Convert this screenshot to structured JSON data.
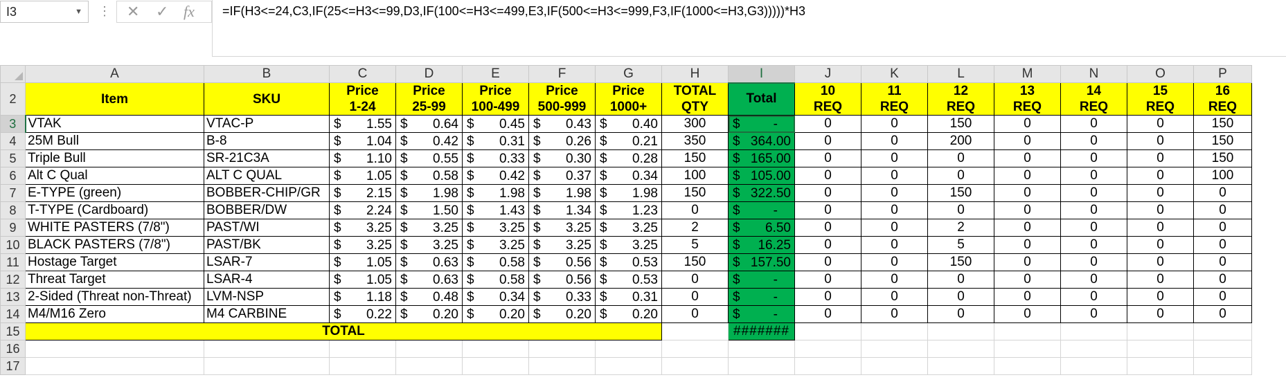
{
  "formula_bar": {
    "name_box": "I3",
    "formula": "=IF(H3<=24,C3,IF(25<=H3<=99,D3,IF(100<=H3<=499,E3,IF(500<=H3<=999,F3,IF(1000<=H3,G3)))))*H3",
    "cancel_glyph": "✕",
    "enter_glyph": "✓",
    "fx_glyph": "fx"
  },
  "columns": [
    "A",
    "B",
    "C",
    "D",
    "E",
    "F",
    "G",
    "H",
    "I",
    "J",
    "K",
    "L",
    "M",
    "N",
    "O",
    "P"
  ],
  "selected_column": "I",
  "selected_row": "3",
  "header_row": {
    "row_num": "2",
    "item": "Item",
    "sku": "SKU",
    "price_labels": [
      {
        "l1": "Price",
        "l2": "1-24"
      },
      {
        "l1": "Price",
        "l2": "25-99"
      },
      {
        "l1": "Price",
        "l2": "100-499"
      },
      {
        "l1": "Price",
        "l2": "500-999"
      },
      {
        "l1": "Price",
        "l2": "1000+"
      }
    ],
    "total_qty": {
      "l1": "TOTAL",
      "l2": "QTY"
    },
    "total": "Total",
    "req_labels": [
      {
        "l1": "10",
        "l2": "REQ"
      },
      {
        "l1": "11",
        "l2": "REQ"
      },
      {
        "l1": "12",
        "l2": "REQ"
      },
      {
        "l1": "13",
        "l2": "REQ"
      },
      {
        "l1": "14",
        "l2": "REQ"
      },
      {
        "l1": "15",
        "l2": "REQ"
      },
      {
        "l1": "16",
        "l2": "REQ"
      }
    ]
  },
  "currency_symbol": "$",
  "rows": [
    {
      "n": "3",
      "item": "VTAK",
      "sku": "VTAC-P",
      "prices": [
        "1.55",
        "0.64",
        "0.45",
        "0.43",
        "0.40"
      ],
      "qty": "300",
      "total": "-",
      "req": [
        "0",
        "0",
        "150",
        "0",
        "0",
        "0",
        "150"
      ]
    },
    {
      "n": "4",
      "item": "25M Bull",
      "sku": "B-8",
      "prices": [
        "1.04",
        "0.42",
        "0.31",
        "0.26",
        "0.21"
      ],
      "qty": "350",
      "total": "364.00",
      "req": [
        "0",
        "0",
        "200",
        "0",
        "0",
        "0",
        "150"
      ]
    },
    {
      "n": "5",
      "item": "Triple Bull",
      "sku": "SR-21C3A",
      "prices": [
        "1.10",
        "0.55",
        "0.33",
        "0.30",
        "0.28"
      ],
      "qty": "150",
      "total": "165.00",
      "req": [
        "0",
        "0",
        "0",
        "0",
        "0",
        "0",
        "150"
      ]
    },
    {
      "n": "6",
      "item": "Alt C Qual",
      "sku": "ALT C QUAL",
      "prices": [
        "1.05",
        "0.58",
        "0.42",
        "0.37",
        "0.34"
      ],
      "qty": "100",
      "total": "105.00",
      "req": [
        "0",
        "0",
        "0",
        "0",
        "0",
        "0",
        "100"
      ]
    },
    {
      "n": "7",
      "item": "E-TYPE (green)",
      "sku": "BOBBER-CHIP/GR",
      "prices": [
        "2.15",
        "1.98",
        "1.98",
        "1.98",
        "1.98"
      ],
      "qty": "150",
      "total": "322.50",
      "req": [
        "0",
        "0",
        "150",
        "0",
        "0",
        "0",
        "0"
      ]
    },
    {
      "n": "8",
      "item": "T-TYPE (Cardboard)",
      "sku": "BOBBER/DW",
      "prices": [
        "2.24",
        "1.50",
        "1.43",
        "1.34",
        "1.23"
      ],
      "qty": "0",
      "total": "-",
      "req": [
        "0",
        "0",
        "0",
        "0",
        "0",
        "0",
        "0"
      ]
    },
    {
      "n": "9",
      "item": "WHITE PASTERS (7/8\")",
      "sku": "PAST/WI",
      "prices": [
        "3.25",
        "3.25",
        "3.25",
        "3.25",
        "3.25"
      ],
      "qty": "2",
      "total": "6.50",
      "req": [
        "0",
        "0",
        "2",
        "0",
        "0",
        "0",
        "0"
      ]
    },
    {
      "n": "10",
      "item": "BLACK PASTERS (7/8\")",
      "sku": "PAST/BK",
      "prices": [
        "3.25",
        "3.25",
        "3.25",
        "3.25",
        "3.25"
      ],
      "qty": "5",
      "total": "16.25",
      "req": [
        "0",
        "0",
        "5",
        "0",
        "0",
        "0",
        "0"
      ]
    },
    {
      "n": "11",
      "item": "Hostage Target",
      "sku": "LSAR-7",
      "prices": [
        "1.05",
        "0.63",
        "0.58",
        "0.56",
        "0.53"
      ],
      "qty": "150",
      "total": "157.50",
      "req": [
        "0",
        "0",
        "150",
        "0",
        "0",
        "0",
        "0"
      ]
    },
    {
      "n": "12",
      "item": "Threat Target",
      "sku": "LSAR-4",
      "prices": [
        "1.05",
        "0.63",
        "0.58",
        "0.56",
        "0.53"
      ],
      "qty": "0",
      "total": "-",
      "req": [
        "0",
        "0",
        "0",
        "0",
        "0",
        "0",
        "0"
      ]
    },
    {
      "n": "13",
      "item": "2-Sided (Threat non-Threat)",
      "sku": "LVM-NSP",
      "prices": [
        "1.18",
        "0.48",
        "0.34",
        "0.33",
        "0.31"
      ],
      "qty": "0",
      "total": "-",
      "req": [
        "0",
        "0",
        "0",
        "0",
        "0",
        "0",
        "0"
      ]
    },
    {
      "n": "14",
      "item": "M4/M16 Zero",
      "sku": "M4 CARBINE",
      "prices": [
        "0.22",
        "0.20",
        "0.20",
        "0.20",
        "0.20"
      ],
      "qty": "0",
      "total": "-",
      "req": [
        "0",
        "0",
        "0",
        "0",
        "0",
        "0",
        "0"
      ]
    }
  ],
  "total_row": {
    "n": "15",
    "label": "TOTAL",
    "value": "#######"
  },
  "empty_rows": [
    "16",
    "17"
  ],
  "colors": {
    "header_yellow": "#ffff00",
    "total_green": "#00b050",
    "selection_green": "#217346"
  }
}
